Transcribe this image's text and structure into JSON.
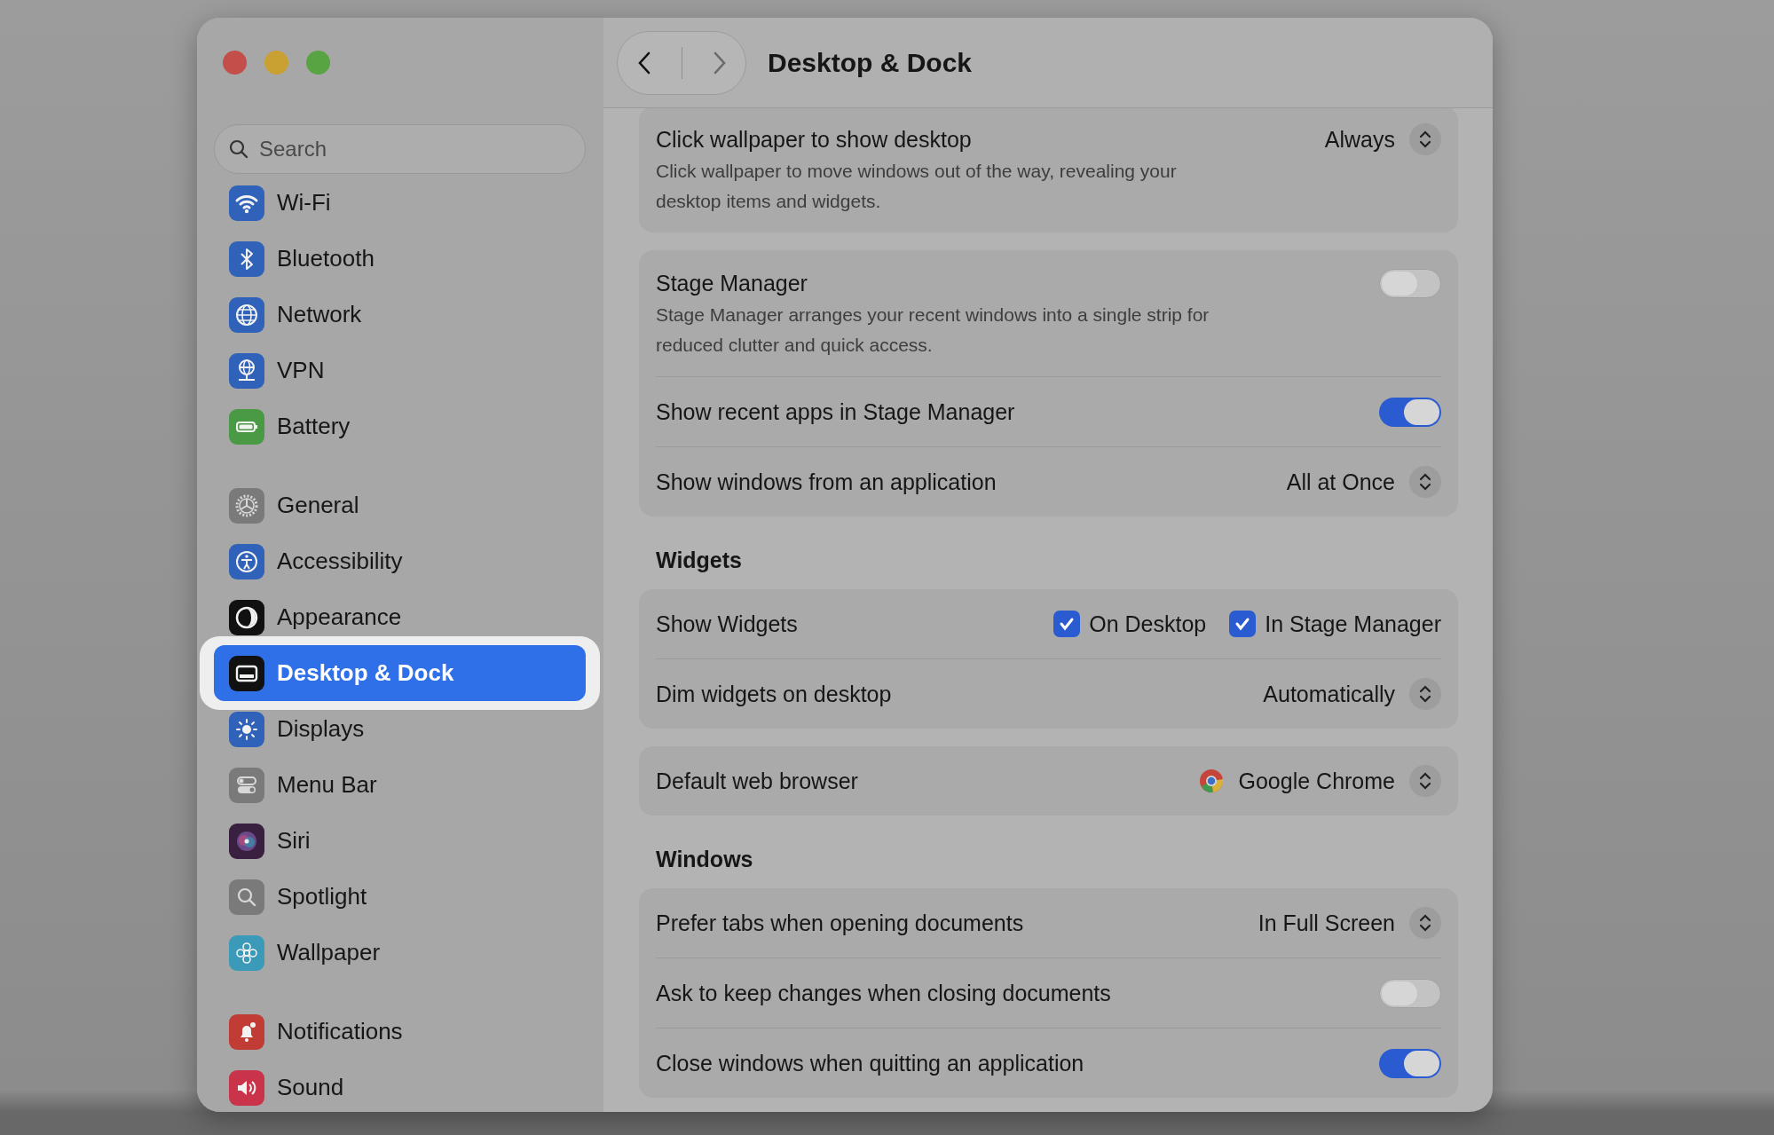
{
  "window": {
    "title": "Desktop & Dock"
  },
  "sidebar": {
    "search": {
      "placeholder": "Search"
    },
    "groups": [
      {
        "items": [
          {
            "label": "Wi-Fi",
            "selected": false
          },
          {
            "label": "Bluetooth",
            "selected": false
          },
          {
            "label": "Network",
            "selected": false
          },
          {
            "label": "VPN",
            "selected": false
          },
          {
            "label": "Battery",
            "selected": false
          }
        ]
      },
      {
        "items": [
          {
            "label": "General",
            "selected": false
          },
          {
            "label": "Accessibility",
            "selected": false
          },
          {
            "label": "Appearance",
            "selected": false
          },
          {
            "label": "Desktop & Dock",
            "selected": true
          },
          {
            "label": "Displays",
            "selected": false
          },
          {
            "label": "Menu Bar",
            "selected": false
          },
          {
            "label": "Siri",
            "selected": false
          },
          {
            "label": "Spotlight",
            "selected": false
          },
          {
            "label": "Wallpaper",
            "selected": false
          }
        ]
      },
      {
        "items": [
          {
            "label": "Notifications",
            "selected": false
          },
          {
            "label": "Sound",
            "selected": false
          }
        ]
      }
    ]
  },
  "sections": [
    {
      "cards": [
        {
          "rows": [
            {
              "kind": "select",
              "label": "Click wallpaper to show desktop",
              "value": "Always",
              "description": "Click wallpaper to move windows out of the way, revealing your desktop items and widgets."
            }
          ]
        },
        {
          "rows": [
            {
              "kind": "toggle",
              "label": "Stage Manager",
              "on": false,
              "description": "Stage Manager arranges your recent windows into a single strip for reduced clutter and quick access."
            },
            {
              "kind": "toggle",
              "label": "Show recent apps in Stage Manager",
              "on": true
            },
            {
              "kind": "select",
              "label": "Show windows from an application",
              "value": "All at Once"
            }
          ]
        }
      ]
    },
    {
      "heading": "Widgets",
      "cards": [
        {
          "rows": [
            {
              "kind": "checks",
              "label": "Show Widgets",
              "options": [
                {
                  "label": "On Desktop",
                  "checked": true
                },
                {
                  "label": "In Stage Manager",
                  "checked": true
                }
              ]
            },
            {
              "kind": "select",
              "label": "Dim widgets on desktop",
              "value": "Automatically"
            }
          ]
        },
        {
          "rows": [
            {
              "kind": "app_select",
              "label": "Default web browser",
              "value": "Google Chrome"
            }
          ]
        }
      ]
    },
    {
      "heading": "Windows",
      "cards": [
        {
          "rows": [
            {
              "kind": "select",
              "label": "Prefer tabs when opening documents",
              "value": "In Full Screen"
            },
            {
              "kind": "toggle",
              "label": "Ask to keep changes when closing documents",
              "on": false
            },
            {
              "kind": "toggle",
              "label": "Close windows when quitting an application",
              "on": true
            }
          ]
        }
      ]
    }
  ]
}
